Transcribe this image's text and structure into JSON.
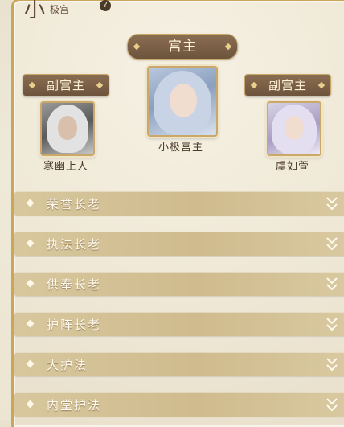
{
  "header": {
    "title_big": "小",
    "title_small": "极宫",
    "info_icon": "question-icon",
    "info_glyph": "?"
  },
  "leader": {
    "rank_label": "宫主",
    "name": "小极宫主",
    "avatar_icon": "avatar-main"
  },
  "vice_left": {
    "rank_label": "副宫主",
    "name": "寒幽上人",
    "avatar_icon": "avatar-elder"
  },
  "vice_right": {
    "rank_label": "副宫主",
    "name": "虞如萱",
    "avatar_icon": "avatar-maiden"
  },
  "ranks": [
    {
      "label": "荣誉长老",
      "expanded": false
    },
    {
      "label": "执法长老",
      "expanded": false
    },
    {
      "label": "供奉长老",
      "expanded": false
    },
    {
      "label": "护阵长老",
      "expanded": false
    },
    {
      "label": "大护法",
      "expanded": false
    },
    {
      "label": "内堂护法",
      "expanded": false
    }
  ],
  "colors": {
    "gold_border": "#c9a86a",
    "banner_brown": "#7a6048",
    "row_gold": "#d3c193"
  }
}
